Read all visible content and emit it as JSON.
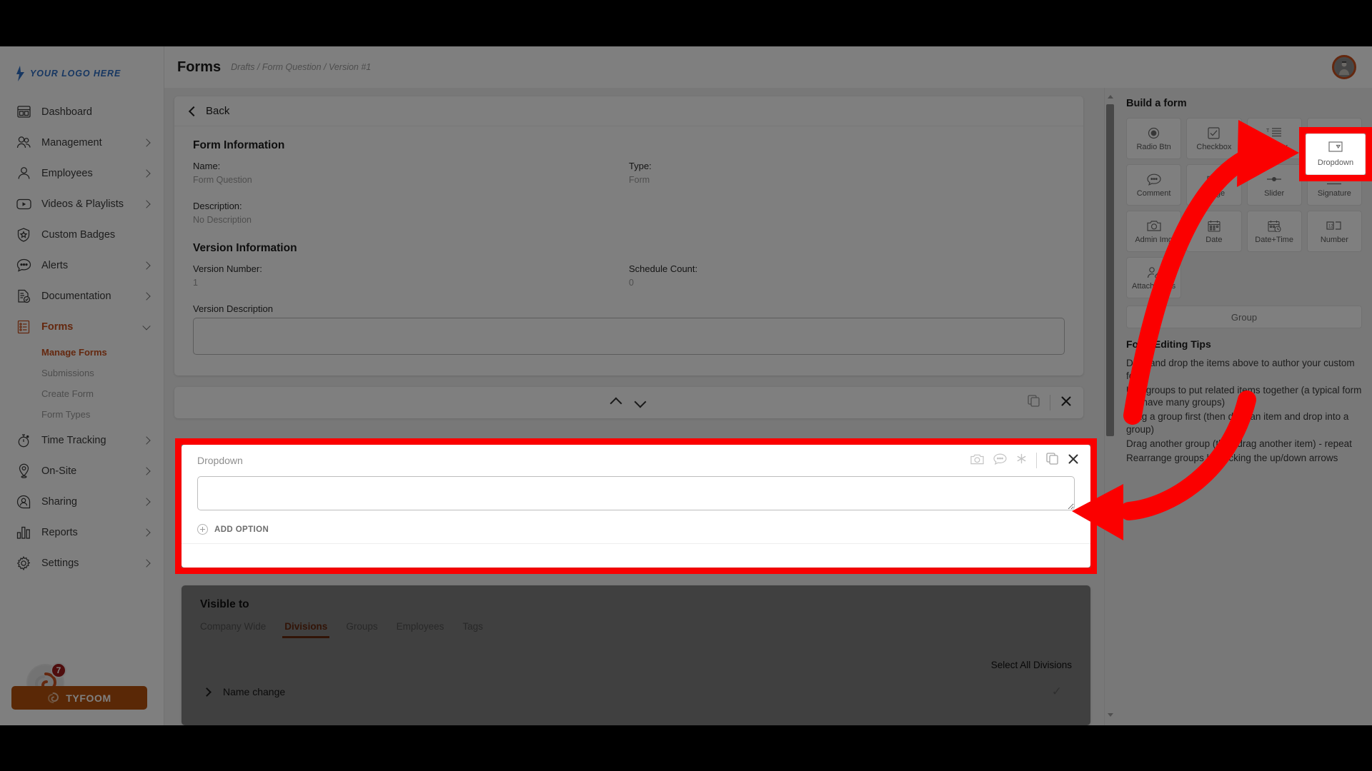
{
  "brand": {
    "accent": "#c8501e",
    "logo_blue": "#2f6fc4",
    "annotation_red": "#fb0000"
  },
  "sidebar": {
    "logo_text": "YOUR LOGO HERE",
    "items": [
      {
        "label": "Dashboard",
        "icon": "dashboard-icon",
        "expandable": false,
        "active": false
      },
      {
        "label": "Management",
        "icon": "management-icon",
        "expandable": true,
        "active": false
      },
      {
        "label": "Employees",
        "icon": "employees-icon",
        "expandable": true,
        "active": false
      },
      {
        "label": "Videos & Playlists",
        "icon": "video-icon",
        "expandable": true,
        "active": false
      },
      {
        "label": "Custom Badges",
        "icon": "badge-icon",
        "expandable": false,
        "active": false
      },
      {
        "label": "Alerts",
        "icon": "alerts-icon",
        "expandable": true,
        "active": false
      },
      {
        "label": "Documentation",
        "icon": "doc-icon",
        "expandable": true,
        "active": false
      },
      {
        "label": "Forms",
        "icon": "forms-icon",
        "expandable": true,
        "active": true
      },
      {
        "label": "Time Tracking",
        "icon": "timer-icon",
        "expandable": true,
        "active": false
      },
      {
        "label": "On-Site",
        "icon": "pin-icon",
        "expandable": true,
        "active": false
      },
      {
        "label": "Sharing",
        "icon": "sharing-icon",
        "expandable": true,
        "active": false
      },
      {
        "label": "Reports",
        "icon": "reports-icon",
        "expandable": true,
        "active": false
      },
      {
        "label": "Settings",
        "icon": "gear-icon",
        "expandable": true,
        "active": false
      }
    ],
    "forms_subitems": [
      {
        "label": "Manage Forms",
        "active": true
      },
      {
        "label": "Submissions",
        "active": false
      },
      {
        "label": "Create Form",
        "active": false
      },
      {
        "label": "Form Types",
        "active": false
      }
    ],
    "footer": {
      "label": "TYFOOM",
      "badge_count": "7"
    }
  },
  "header": {
    "title": "Forms",
    "breadcrumb": "Drafts / Form Question / Version #1"
  },
  "main": {
    "back_label": "Back",
    "form_information": {
      "section_title": "Form Information",
      "name_label": "Name:",
      "name_value": "Form Question",
      "type_label": "Type:",
      "type_value": "Form",
      "description_label": "Description:",
      "description_value": "No Description"
    },
    "version_information": {
      "section_title": "Version Information",
      "version_number_label": "Version Number:",
      "version_number_value": "1",
      "schedule_count_label": "Schedule Count:",
      "schedule_count_value": "0",
      "version_description_label": "Version Description",
      "version_description_value": ""
    },
    "question": {
      "type_label": "Dropdown",
      "text_value": "",
      "add_option_label": "ADD OPTION",
      "tools": [
        "camera-icon",
        "comment-icon",
        "required-asterisk-icon",
        "duplicate-icon",
        "close-icon"
      ]
    },
    "group_toolbar": {
      "move_up": "chevron-up-icon",
      "move_down": "chevron-down-icon",
      "duplicate": "duplicate-icon",
      "close": "close-icon"
    },
    "visible_to": {
      "section_title": "Visible to",
      "tabs": [
        {
          "label": "Company Wide",
          "active": false
        },
        {
          "label": "Divisions",
          "active": true
        },
        {
          "label": "Groups",
          "active": false
        },
        {
          "label": "Employees",
          "active": false
        },
        {
          "label": "Tags",
          "active": false
        }
      ],
      "select_all_label": "Select All Divisions",
      "rows": [
        {
          "label": "Name change",
          "checked": false
        }
      ]
    }
  },
  "right_panel": {
    "title": "Build a form",
    "tiles": [
      {
        "label": "Radio Btn",
        "icon": "radio-button-icon",
        "highlighted": false
      },
      {
        "label": "Checkbox",
        "icon": "checkbox-icon",
        "highlighted": false
      },
      {
        "label": "Textbox",
        "icon": "textbox-icon",
        "highlighted": false
      },
      {
        "label": "Dropdown",
        "icon": "dropdown-icon",
        "highlighted": true
      },
      {
        "label": "Comment",
        "icon": "comment-icon",
        "highlighted": false
      },
      {
        "label": "Image",
        "icon": "camera-icon",
        "highlighted": false
      },
      {
        "label": "Slider",
        "icon": "slider-icon",
        "highlighted": false
      },
      {
        "label": "Signature",
        "icon": "signature-icon",
        "highlighted": false
      },
      {
        "label": "Admin Img",
        "icon": "camera-icon",
        "highlighted": false
      },
      {
        "label": "Date",
        "icon": "calendar-icon",
        "highlighted": false
      },
      {
        "label": "Date+Time",
        "icon": "calendar-clock-icon",
        "highlighted": false
      },
      {
        "label": "Number",
        "icon": "number-icon",
        "highlighted": false
      },
      {
        "label": "Attachments",
        "icon": "attachment-icon",
        "highlighted": false
      }
    ],
    "group_button_label": "Group",
    "tips_title": "Form Editing Tips",
    "tips": [
      "Drag and drop the items above to author your custom form",
      "Use groups to put related items together (a typical form will have many groups)",
      "Drag a group first (then drag an item and drop into a group)",
      "Drag another group (then drag another item) - repeat",
      "Rearrange groups by clicking the up/down arrows"
    ]
  },
  "highlight_label": "Dropdown"
}
